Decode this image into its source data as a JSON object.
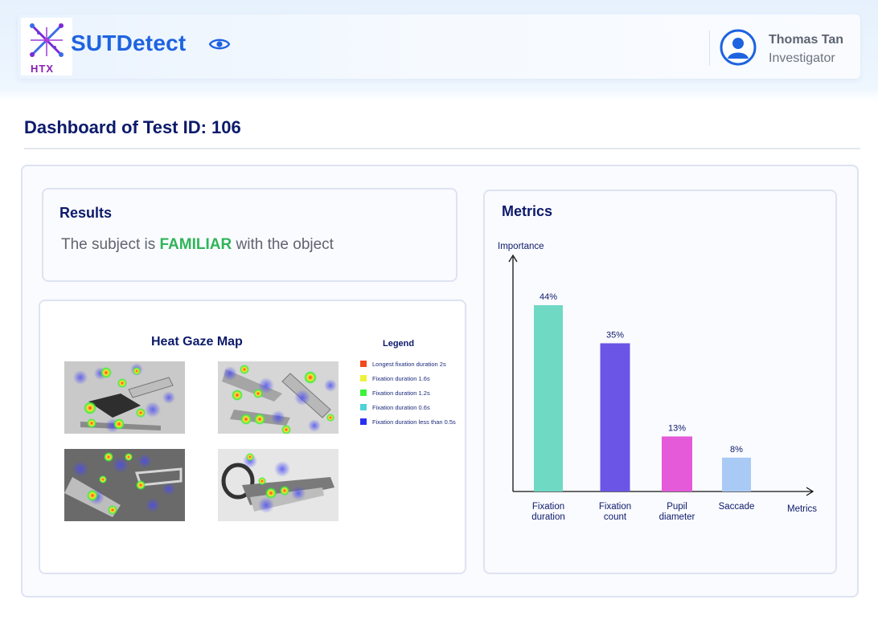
{
  "header": {
    "logo_text": "HTX",
    "app_name": "SUTDetect",
    "user": {
      "name": "Thomas Tan",
      "role": "Investigator"
    }
  },
  "page": {
    "title": "Dashboard of Test ID: 106"
  },
  "results": {
    "title": "Results",
    "text_before": "The subject is ",
    "verdict": "FAMILIAR",
    "text_after": " with the object",
    "verdict_color": "#2fb45a"
  },
  "heatmap": {
    "title": "Heat Gaze Map",
    "legend_title": "Legend",
    "legend": [
      {
        "label": "Longest fixation duration 2s",
        "color": "#f04a1e"
      },
      {
        "label": "Fixation duration 1.6s",
        "color": "#eef23a"
      },
      {
        "label": "Fixation duration 1.2s",
        "color": "#3cf23c"
      },
      {
        "label": "Fixation duration 0.6s",
        "color": "#4fd3d8"
      },
      {
        "label": "Fixation duration less than 0.5s",
        "color": "#2a2ff0"
      }
    ]
  },
  "metrics": {
    "title": "Metrics"
  },
  "chart_data": {
    "type": "bar",
    "xlabel": "Metrics",
    "ylabel": "Importance",
    "categories": [
      "Fixation\nduration",
      "Fixation\ncount",
      "Pupil\ndiameter",
      "Saccade"
    ],
    "values": [
      44,
      35,
      13,
      8
    ],
    "value_labels": [
      "44%",
      "35%",
      "13%",
      "8%"
    ],
    "colors": [
      "#6fd9c4",
      "#6a55e6",
      "#e45ad8",
      "#a9caf4"
    ],
    "ylim": [
      0,
      50
    ]
  }
}
